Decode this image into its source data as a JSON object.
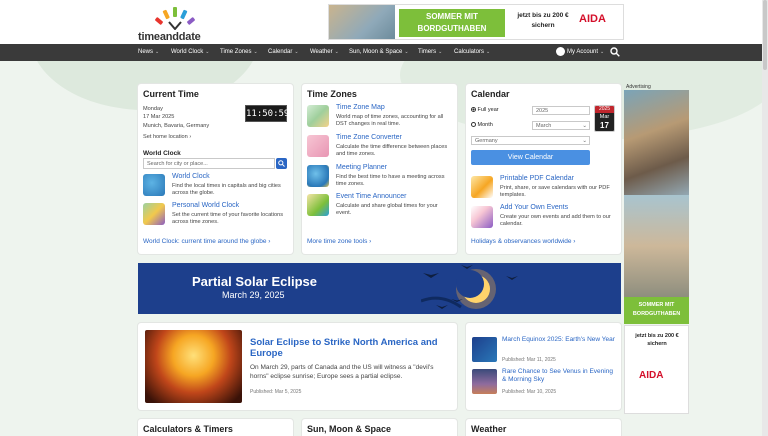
{
  "logo": {
    "wordmark": "timeanddate"
  },
  "ad_top": {
    "headline": "SOMMER MIT BORDGUTHABEN",
    "price": "jetzt bis zu 200 € sichern",
    "brand": "AIDA"
  },
  "nav": {
    "items": [
      "News",
      "World Clock",
      "Time Zones",
      "Calendar",
      "Weather",
      "Sun, Moon & Space",
      "Timers",
      "Calculators"
    ],
    "account": "My Account"
  },
  "current_time": {
    "title": "Current Time",
    "day": "Monday",
    "date": "17 Mar 2025",
    "location": "Munich, Bavaria, Germany",
    "home_link": "Set home location",
    "clock": "11:50:59",
    "world_clock_label": "World Clock",
    "search_placeholder": "Search for city or place...",
    "items": [
      {
        "title": "World Clock",
        "desc": "Find the local times in capitals and big cities across the globe."
      },
      {
        "title": "Personal World Clock",
        "desc": "Set the current time of your favorite locations across time zones."
      }
    ],
    "footer": "World Clock: current time around the globe"
  },
  "time_zones": {
    "title": "Time Zones",
    "items": [
      {
        "title": "Time Zone Map",
        "desc": "World map of time zones, accounting for all DST changes in real time."
      },
      {
        "title": "Time Zone Converter",
        "desc": "Calculate the time difference between places and time zones."
      },
      {
        "title": "Meeting Planner",
        "desc": "Find the best time to have a meeting across time zones."
      },
      {
        "title": "Event Time Announcer",
        "desc": "Calculate and share global times for your event."
      }
    ],
    "footer": "More time zone tools"
  },
  "calendar": {
    "title": "Calendar",
    "full_year": "Full year",
    "year_value": "2025",
    "month": "Month",
    "month_value": "March",
    "country_value": "Germany",
    "badge": {
      "year": "2025",
      "month": "Mar",
      "day": "17"
    },
    "button": "View Calendar",
    "items": [
      {
        "title": "Printable PDF Calendar",
        "desc": "Print, share, or save calendars with our PDF templates."
      },
      {
        "title": "Add Your Own Events",
        "desc": "Create your own events and add them to our calendar."
      }
    ],
    "footer": "Holidays & observances worldwide"
  },
  "banner": {
    "title": "Partial Solar Eclipse",
    "date": "March 29, 2025"
  },
  "article": {
    "title": "Solar Eclipse to Strike North America and Europe",
    "summary": "On March 29, parts of Canada and the US will witness a \"devil's horns\" eclipse sunrise; Europe sees a partial eclipse.",
    "published": "Published: Mar 5, 2025"
  },
  "news_items": [
    {
      "title": "March Equinox 2025: Earth's New Year",
      "published": "Published: Mar 11, 2025"
    },
    {
      "title": "Rare Chance to See Venus in Evening & Morning Sky",
      "published": "Published: Mar 10, 2025"
    }
  ],
  "bottom_cards": [
    "Calculators & Timers",
    "Sun, Moon & Space",
    "Weather"
  ],
  "ad_side": {
    "label": "Advertising",
    "headline": "SOMMER MIT BORDGUTHABEN",
    "price": "jetzt bis zu 200 € sichern",
    "brand": "AIDA"
  },
  "colors": {
    "accent": "#2a66c4",
    "nav": "#3a3a3a",
    "banner": "#1d3f8c",
    "button": "#4a90e2",
    "ad_green": "#7dbf3a",
    "aida_red": "#d40f2a"
  }
}
